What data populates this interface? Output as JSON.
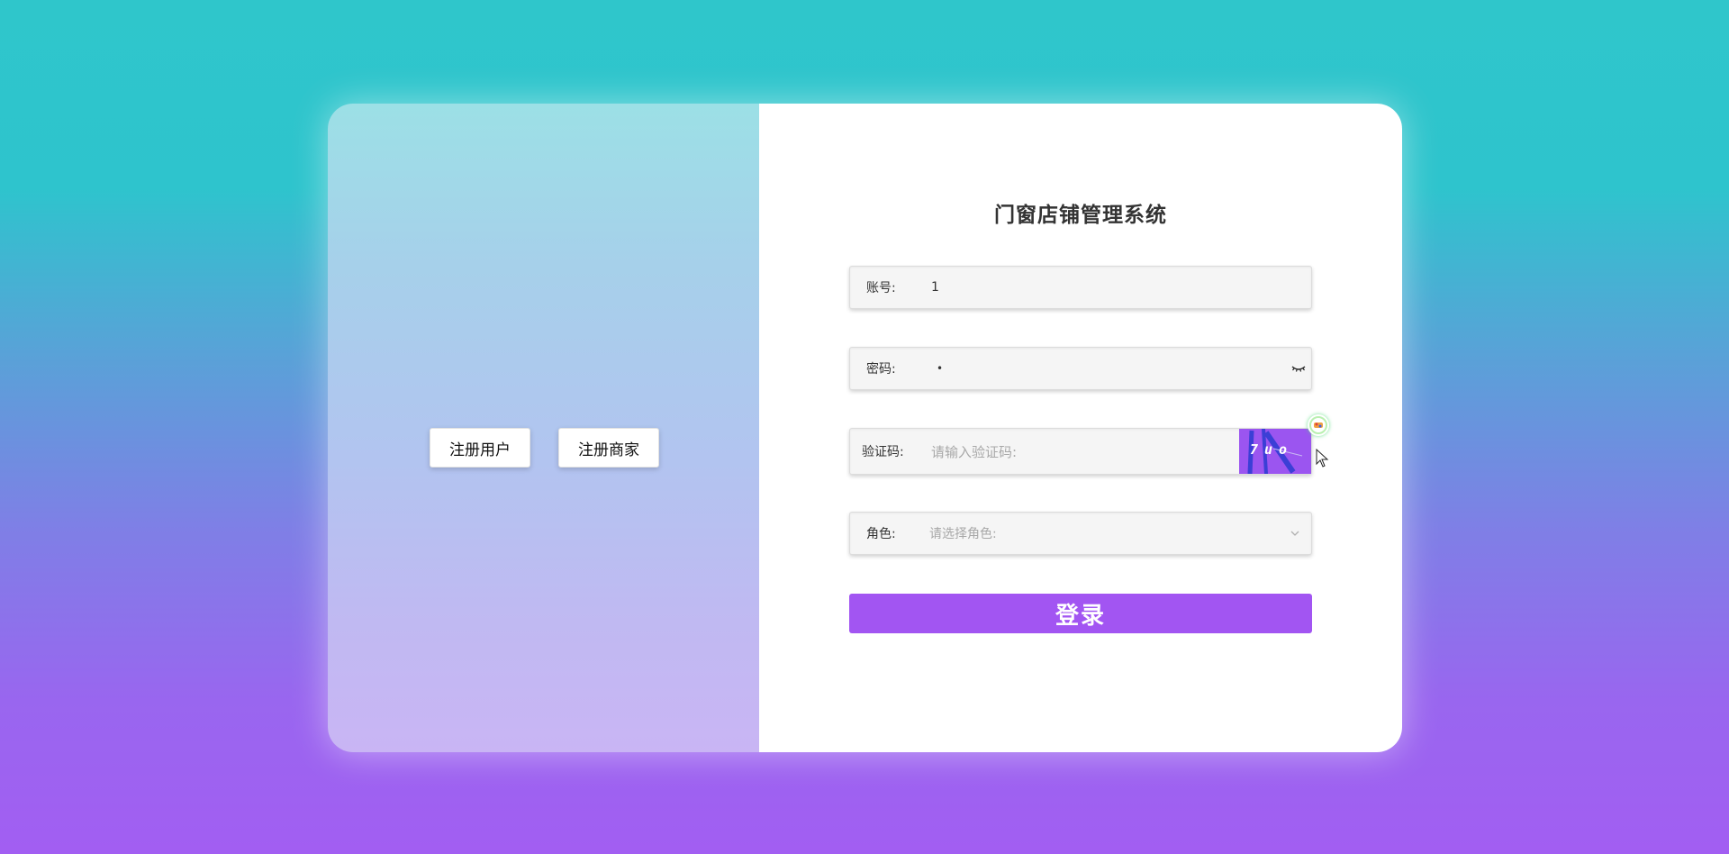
{
  "register": {
    "user_label": "注册用户",
    "merchant_label": "注册商家"
  },
  "login": {
    "title": "门窗店铺管理系统",
    "account_label": "账号:",
    "account_value": "1",
    "password_label": "密码:",
    "password_value": "•",
    "captcha_label": "验证码:",
    "captcha_placeholder": "请输入验证码:",
    "captcha_code": "7uo",
    "role_label": "角色:",
    "role_placeholder": "请选择角色:",
    "submit_label": "登录"
  },
  "icons": {
    "eye": "eye-closed-icon",
    "chevron": "chevron-down-icon",
    "extension": "browser-extension-icon",
    "cursor": "mouse-cursor-icon"
  },
  "colors": {
    "accent": "#a255f2",
    "captcha_bg": "#9b55f0",
    "bg_top": "#2fc6cb",
    "bg_bottom": "#a25ef2"
  }
}
